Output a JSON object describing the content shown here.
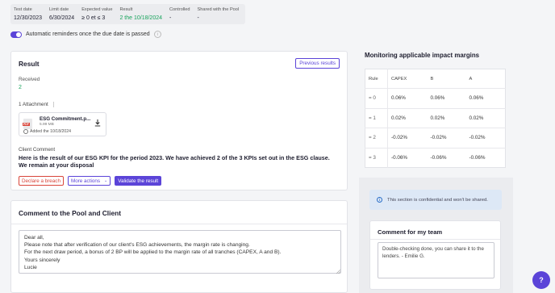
{
  "summary": {
    "test_date_label": "Test date",
    "test_date": "12/30/2023",
    "limit_date_label": "Limit date",
    "limit_date": "6/30/2024",
    "expected_label": "Expected value",
    "expected": "≥ 0 et ≤ 3",
    "result_label": "Result",
    "result": "2 the 10/18/2024",
    "controlled_label": "Controlled",
    "controlled": "-",
    "shared_label": "Shared with the Pool",
    "shared": "-"
  },
  "reminders": {
    "label": "Automatic reminders once the due date is passed",
    "enabled": true,
    "info_glyph": "i"
  },
  "result_card": {
    "title": "Result",
    "previous_results": "Previous results",
    "received_label": "Received",
    "received_value": "2",
    "attachment_label": "1 Attachment",
    "file": {
      "name": "ESG Commitment.p...",
      "size": "5.99 MB",
      "added": "Added the 10/18/2024",
      "type_badge": "PDF"
    },
    "client_comment_label": "Client Comment",
    "client_comment": "Here is the result of our ESG KPI for the period 2023. We have achieved 2 of the 3 KPIs set out in the ESG clause. We remain at your disposal",
    "declare_breach": "Declare a breach",
    "more_actions": "More actions",
    "more_actions_chevron": "⌄",
    "validate": "Validate the result"
  },
  "comment_card": {
    "title": "Comment to the Pool and Client",
    "text": "Dear all,\nPlease note that after verification of our client's ESG achievements, the margin rate is changing.\nFor the next draw period, a bonus of 2 BP will be applied to the margin rate of all tranches (CAPEX, A and B).\nYours sincerely\nLucie"
  },
  "monitoring": {
    "title": "Monitoring applicable impact margins",
    "headers": [
      "Rule",
      "CAPEX",
      "B",
      "A"
    ],
    "rows": [
      [
        "= 0",
        "0.06%",
        "0.06%",
        "0.06%"
      ],
      [
        "= 1",
        "0.02%",
        "0.02%",
        "0.02%"
      ],
      [
        "= 2",
        "-0.02%",
        "-0.02%",
        "-0.02%"
      ],
      [
        "= 3",
        "-0.06%",
        "-0.06%",
        "-0.06%"
      ]
    ]
  },
  "confidential": {
    "icon_glyph": "i",
    "text": "This section is confidential and won't be shared."
  },
  "team_comment": {
    "title": "Comment for my team",
    "text": "Double-checking done, you can share it to the lenders. - Emilie G."
  },
  "help": {
    "label": "?"
  },
  "colors": {
    "accent": "#5b44d8",
    "success": "#18a35c",
    "danger": "#d9453a",
    "info_bg": "#dde8f6"
  }
}
